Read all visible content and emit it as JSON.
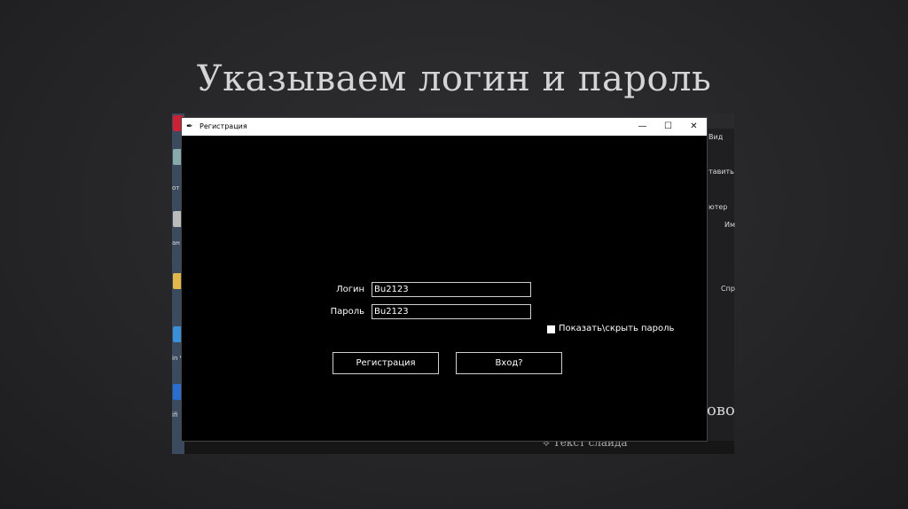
{
  "slide": {
    "title": "Указываем логин и пароль"
  },
  "background": {
    "right_panel": [
      "Вид",
      "тавить",
      "ютер",
      "Им",
      "Спр"
    ],
    "left_panel": [
      "от",
      "ан",
      "in V",
      "ifi"
    ],
    "bottom_text": "Текст слайда",
    "large_text": "ово"
  },
  "window": {
    "title": "Регистрация",
    "app_icon": "feather-pen-icon",
    "controls": {
      "minimize": "—",
      "maximize": "☐",
      "close": "✕"
    }
  },
  "form": {
    "login_label": "Логин",
    "login_value": "Bu2123",
    "password_label": "Пароль",
    "password_value": "Bu2123",
    "show_password_label": "Показать\\скрыть пароль",
    "show_password_checked": true,
    "register_button": "Регистрация",
    "login_button": "Вход?"
  },
  "colors": {
    "window_bg": "#000000",
    "titlebar_bg": "#ffffff",
    "slide_bg": "#262628",
    "text": "#ffffff"
  }
}
